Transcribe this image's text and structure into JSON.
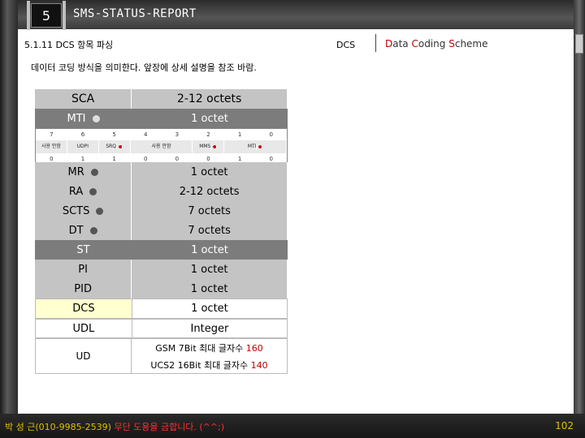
{
  "slide": {
    "number": "5",
    "title": "SMS-STATUS-REPORT",
    "heading": "5.1.11 DCS 항목 파싱",
    "description": "데이터 코딩 방식을 의미한다.   앞장에 상세 설명을 참조 바람.",
    "dcs_label": "DCS",
    "dcs_meaning_parts": [
      "D",
      "ata ",
      "C",
      "oding ",
      "S",
      "cheme"
    ]
  },
  "table": {
    "rows": [
      {
        "field": "SCA",
        "size": "2-12 octets"
      },
      {
        "field": "MTI",
        "size": "1 octet"
      },
      {
        "field": "MR",
        "size": "1 octet"
      },
      {
        "field": "RA",
        "size": "2-12 octets"
      },
      {
        "field": "SCTS",
        "size": "7 octets"
      },
      {
        "field": "DT",
        "size": "7 octets"
      },
      {
        "field": "ST",
        "size": "1 octet"
      },
      {
        "field": "PI",
        "size": "1 octet"
      },
      {
        "field": "PID",
        "size": "1 octet"
      },
      {
        "field": "DCS",
        "size": "1 octet"
      },
      {
        "field": "UDL",
        "size": "Integer"
      }
    ],
    "bit_numbers": [
      "7",
      "6",
      "5",
      "4",
      "3",
      "2",
      "1",
      "0"
    ],
    "bit_names": [
      "사용 안함",
      "UDPI",
      "SRQ",
      "사용 안함",
      "MMS",
      "MTI"
    ],
    "bit_values": [
      "0",
      "1",
      "1",
      "0",
      "0",
      "0",
      "1",
      "0"
    ],
    "ud": {
      "field": "UD",
      "line1_text": "GSM 7Bit 최대 글자수 ",
      "line1_num": "160",
      "line2_text": "UCS2 16Bit 최대 글자수 ",
      "line2_num": "140"
    }
  },
  "footer": {
    "text_main": "박 성 근(010-9985-2539) ",
    "text_accent": "무단 도용을 금합니다. (^^;)",
    "page": "102"
  }
}
